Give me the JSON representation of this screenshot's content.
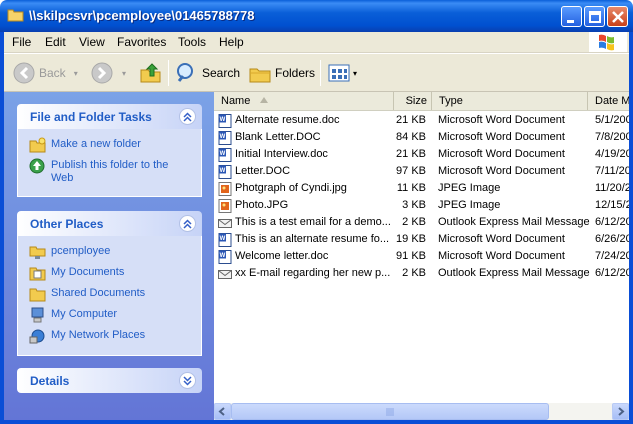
{
  "window": {
    "title": "\\\\skilpcsvr\\pcemployee\\01465788778"
  },
  "menu": [
    "File",
    "Edit",
    "View",
    "Favorites",
    "Tools",
    "Help"
  ],
  "toolbar": {
    "back": "Back",
    "search": "Search",
    "folders": "Folders"
  },
  "file_tasks": {
    "title": "File and Folder Tasks",
    "items": [
      {
        "label": "Make a new folder",
        "icon": "new-folder-icon"
      },
      {
        "label": "Publish this folder to the Web",
        "icon": "publish-web-icon"
      }
    ]
  },
  "other_places": {
    "title": "Other Places",
    "items": [
      {
        "label": "pcemployee",
        "icon": "network-folder-icon"
      },
      {
        "label": "My Documents",
        "icon": "my-documents-icon"
      },
      {
        "label": "Shared Documents",
        "icon": "folder-icon"
      },
      {
        "label": "My Computer",
        "icon": "my-computer-icon"
      },
      {
        "label": "My Network Places",
        "icon": "network-places-icon"
      }
    ]
  },
  "details": {
    "title": "Details"
  },
  "columns": {
    "name": "Name",
    "size": "Size",
    "type": "Type",
    "date": "Date M"
  },
  "files": [
    {
      "name": "Alternate resume.doc",
      "size": "21 KB",
      "type": "Microsoft Word Document",
      "date": "5/1/200",
      "icon": "word-doc-icon"
    },
    {
      "name": "Blank Letter.DOC",
      "size": "84 KB",
      "type": "Microsoft Word Document",
      "date": "7/8/200",
      "icon": "word-doc-icon"
    },
    {
      "name": "Initial Interview.doc",
      "size": "21 KB",
      "type": "Microsoft Word Document",
      "date": "4/19/20",
      "icon": "word-doc-icon"
    },
    {
      "name": "Letter.DOC",
      "size": "97 KB",
      "type": "Microsoft Word Document",
      "date": "7/11/20",
      "icon": "word-doc-icon"
    },
    {
      "name": "Photgraph of Cyndi.jpg",
      "size": "11 KB",
      "type": "JPEG Image",
      "date": "11/20/2",
      "icon": "jpeg-icon"
    },
    {
      "name": "Photo.JPG",
      "size": "3 KB",
      "type": "JPEG Image",
      "date": "12/15/2",
      "icon": "jpeg-icon"
    },
    {
      "name": "This is a test email for a demo...",
      "size": "2 KB",
      "type": "Outlook Express Mail Message",
      "date": "6/12/20",
      "icon": "mail-icon"
    },
    {
      "name": "This is an alternate resume fo...",
      "size": "19 KB",
      "type": "Microsoft Word Document",
      "date": "6/26/20",
      "icon": "word-doc-icon"
    },
    {
      "name": "Welcome letter.doc",
      "size": "91 KB",
      "type": "Microsoft Word Document",
      "date": "7/24/20",
      "icon": "word-doc-icon"
    },
    {
      "name": "xx E-mail regarding her new p...",
      "size": "2 KB",
      "type": "Outlook Express Mail Message",
      "date": "6/12/20",
      "icon": "mail-icon"
    }
  ]
}
